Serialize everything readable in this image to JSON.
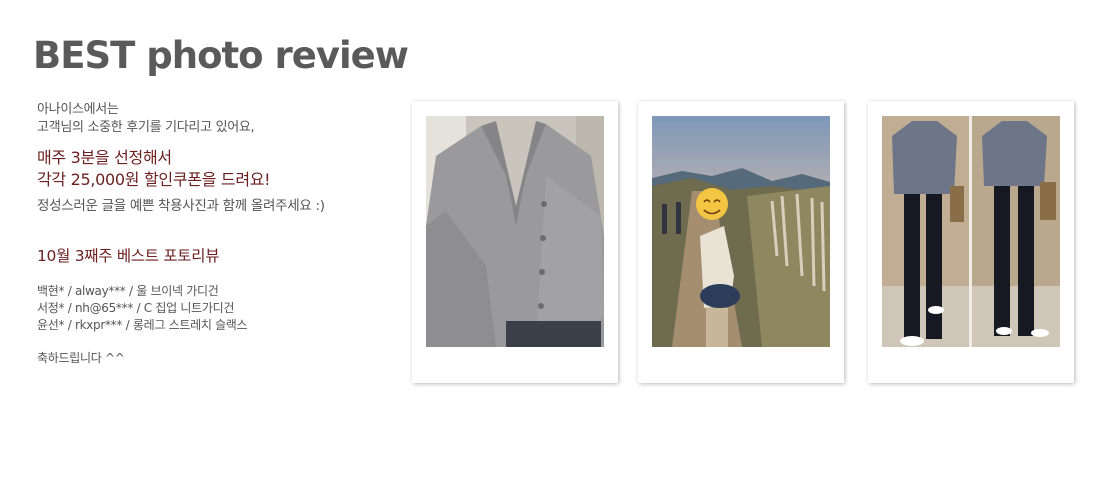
{
  "page": {
    "title": "BEST photo review"
  },
  "intro": {
    "line1": "아나이스에서는",
    "line2": "고객님의 소중한 후기를 기다리고 있어요,"
  },
  "offer": {
    "line1": "매주 3분을 선정해서",
    "line2": "각각 25,000원 할인쿠폰을 드려요!"
  },
  "request": "정성스러운 글을 예쁜 착용사진과 함께 올려주세요 :)",
  "week_title": "10월 3째주 베스트 포토리뷰",
  "winners": [
    "백현* / alway*** / 울 브이넥 가디건",
    "서정* / nh@65*** / C 집업 니트가디건",
    "윤선* / rkxpr*** / 롱레그 스트레치 슬랙스"
  ],
  "congrats": "축하드립니다 ^^",
  "photos": [
    {
      "subject": "gray V-neck knit cardigan selfie"
    },
    {
      "subject": "woman on mountain trail with pampas grass at sunset"
    },
    {
      "subject": "two mirror selfies in gray knit and black wide slacks"
    }
  ],
  "colors": {
    "title": "#5a5a5a",
    "body_text": "#555555",
    "highlight": "#6b1f1f"
  }
}
